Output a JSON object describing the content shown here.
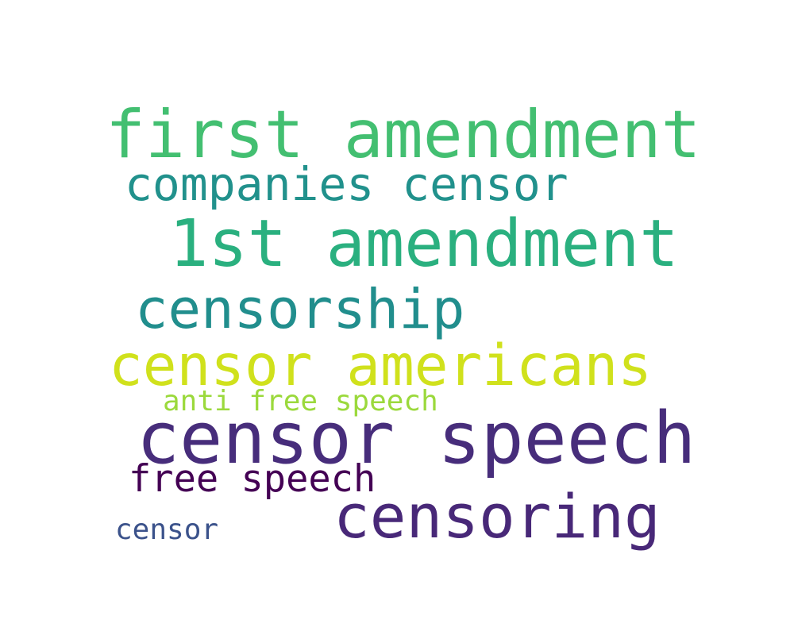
{
  "words": [
    {
      "text": "first amendment",
      "color": "#43bf71"
    },
    {
      "text": "companies censor",
      "color": "#21918c"
    },
    {
      "text": "1st amendment",
      "color": "#2ab07f"
    },
    {
      "text": "censorship",
      "color": "#218e8d"
    },
    {
      "text": "censor americans",
      "color": "#d0e11c"
    },
    {
      "text": "anti free speech",
      "color": "#9bd93c"
    },
    {
      "text": "censor speech",
      "color": "#472d7b"
    },
    {
      "text": "free speech",
      "color": "#440154"
    },
    {
      "text": "censoring",
      "color": "#482878"
    },
    {
      "text": "censor",
      "color": "#3b528b"
    }
  ]
}
